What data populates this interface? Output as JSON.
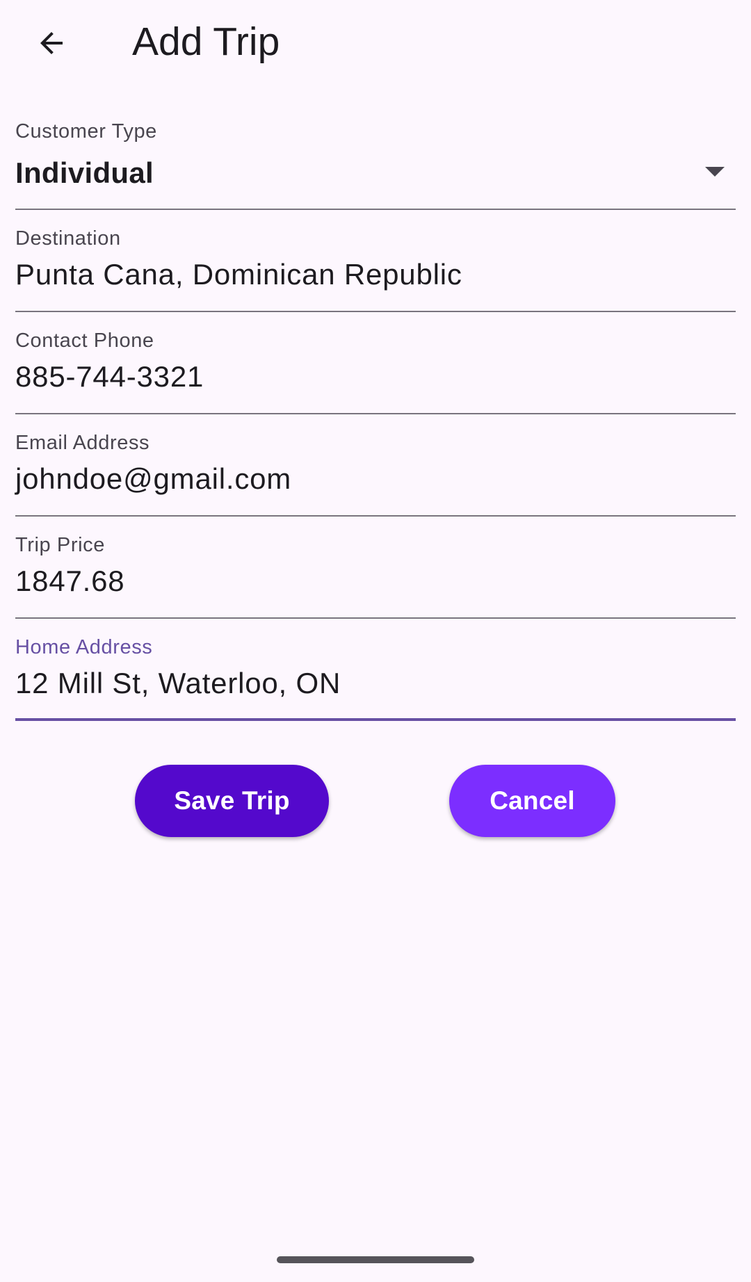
{
  "app_bar": {
    "title": "Add Trip",
    "back_icon": "arrow-back-icon"
  },
  "form": {
    "customer_type": {
      "label": "Customer Type",
      "value": "Individual",
      "icon": "dropdown-arrow-icon"
    },
    "destination": {
      "label": "Destination",
      "value": "Punta Cana, Dominican Republic"
    },
    "contact_phone": {
      "label": "Contact Phone",
      "value": "885-744-3321"
    },
    "email_address": {
      "label": "Email Address",
      "value": "johndoe@gmail.com"
    },
    "trip_price": {
      "label": "Trip Price",
      "value": "1847.68"
    },
    "home_address": {
      "label": "Home Address",
      "value": "12 Mill St, Waterloo, ON",
      "focused": true
    }
  },
  "buttons": {
    "save_label": "Save Trip",
    "cancel_label": "Cancel"
  },
  "colors": {
    "background": "#FDF7FE",
    "focus_accent": "#6750A4",
    "save_button": "#5409CC",
    "cancel_button": "#7C2EFF"
  }
}
